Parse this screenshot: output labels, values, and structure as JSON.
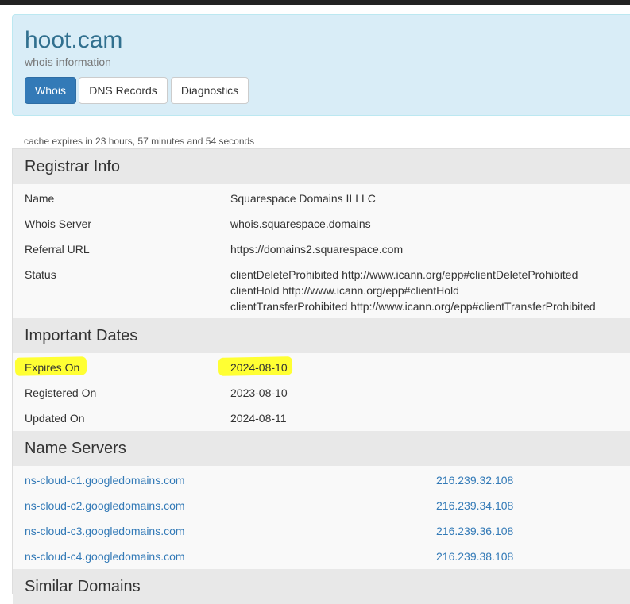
{
  "header": {
    "site_title": "hoot.cam",
    "subtitle": "whois information",
    "tabs": [
      {
        "label": "Whois",
        "active": true
      },
      {
        "label": "DNS Records",
        "active": false
      },
      {
        "label": "Diagnostics",
        "active": false
      }
    ]
  },
  "cache_note": "cache expires in 23 hours, 57 minutes and 54 seconds",
  "registrar": {
    "heading": "Registrar Info",
    "rows": [
      {
        "label": "Name",
        "value": "Squarespace Domains II LLC"
      },
      {
        "label": "Whois Server",
        "value": "whois.squarespace.domains"
      },
      {
        "label": "Referral URL",
        "value": "https://domains2.squarespace.com"
      },
      {
        "label": "Status",
        "values": [
          "clientDeleteProhibited http://www.icann.org/epp#clientDeleteProhibited",
          "clientHold http://www.icann.org/epp#clientHold",
          "clientTransferProhibited http://www.icann.org/epp#clientTransferProhibited"
        ]
      }
    ]
  },
  "dates": {
    "heading": "Important Dates",
    "rows": [
      {
        "label": "Expires On",
        "value": "2024-08-10",
        "highlighted": true
      },
      {
        "label": "Registered On",
        "value": "2023-08-10"
      },
      {
        "label": "Updated On",
        "value": "2024-08-11"
      }
    ]
  },
  "name_servers": {
    "heading": "Name Servers",
    "rows": [
      {
        "host": "ns-cloud-c1.googledomains.com",
        "ip": "216.239.32.108"
      },
      {
        "host": "ns-cloud-c2.googledomains.com",
        "ip": "216.239.34.108"
      },
      {
        "host": "ns-cloud-c3.googledomains.com",
        "ip": "216.239.36.108"
      },
      {
        "host": "ns-cloud-c4.googledomains.com",
        "ip": "216.239.38.108"
      }
    ]
  },
  "similar": {
    "heading": "Similar Domains"
  },
  "colors": {
    "link": "#337ab7",
    "title": "#31708f",
    "highlight": "#ffff33"
  }
}
